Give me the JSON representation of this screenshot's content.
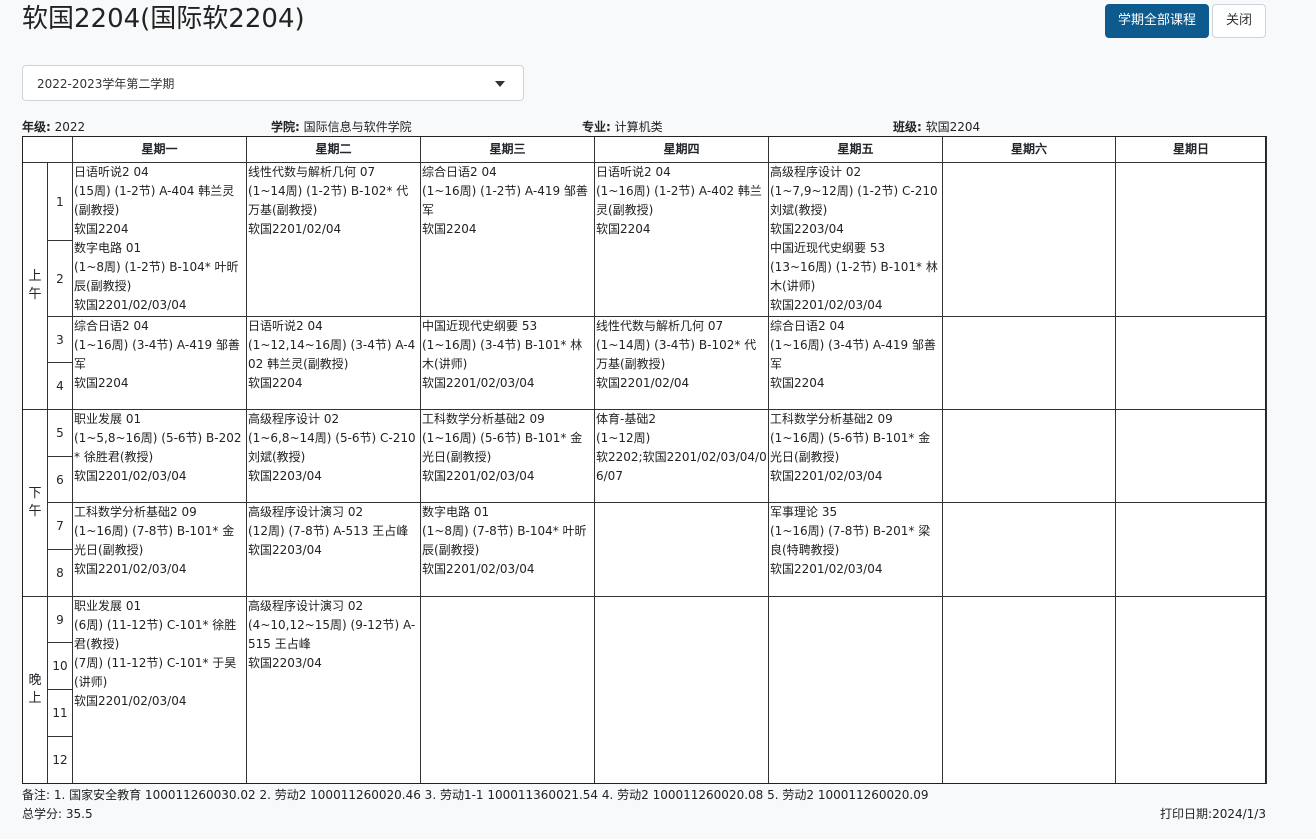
{
  "page_title": "软国2204(国际软2204)",
  "buttons": {
    "all_courses": "学期全部课程",
    "close": "关闭"
  },
  "semester_select": {
    "value": "2022-2023学年第二学期"
  },
  "info": {
    "grade_label": "年级:",
    "grade": "2022",
    "college_label": "学院:",
    "college": "国际信息与软件学院",
    "major_label": "专业:",
    "major": "计算机类",
    "class_label": "班级:",
    "class": "软国2204"
  },
  "days": [
    "星期一",
    "星期二",
    "星期三",
    "星期四",
    "星期五",
    "星期六",
    "星期日"
  ],
  "sessions": [
    "上午",
    "下午",
    "晚上"
  ],
  "periods": [
    "1",
    "2",
    "3",
    "4",
    "5",
    "6",
    "7",
    "8",
    "9",
    "10",
    "11",
    "12"
  ],
  "courses": {
    "mon_12": [
      "日语听说2 04",
      "(15周) (1-2节) A-404 韩兰灵(副教授)",
      "软国2204",
      "数字电路 01",
      "(1~8周) (1-2节) B-104* 叶昕辰(副教授)",
      "软国2201/02/03/04"
    ],
    "tue_12": [
      "线性代数与解析几何 07",
      "(1~14周) (1-2节) B-102* 代万基(副教授)",
      "软国2201/02/04"
    ],
    "wed_12": [
      "综合日语2 04",
      "(1~16周) (1-2节) A-419 邹善军",
      "软国2204"
    ],
    "thu_12": [
      "日语听说2 04",
      "(1~16周) (1-2节) A-402 韩兰灵(副教授)",
      "软国2204"
    ],
    "fri_12": [
      "高级程序设计 02",
      "(1~7,9~12周) (1-2节) C-210 刘斌(教授)",
      "软国2203/04",
      "中国近现代史纲要 53",
      "(13~16周) (1-2节) B-101* 林木(讲师)",
      "软国2201/02/03/04"
    ],
    "mon_34": [
      "综合日语2 04",
      "(1~16周) (3-4节) A-419 邹善军",
      "软国2204"
    ],
    "tue_34": [
      "日语听说2 04",
      "(1~12,14~16周) (3-4节) A-402 韩兰灵(副教授)",
      "软国2204"
    ],
    "wed_34": [
      "中国近现代史纲要 53",
      "(1~16周) (3-4节) B-101* 林木(讲师)",
      "软国2201/02/03/04"
    ],
    "thu_34": [
      "线性代数与解析几何 07",
      "(1~14周) (3-4节) B-102* 代万基(副教授)",
      "软国2201/02/04"
    ],
    "fri_34": [
      "综合日语2 04",
      "(1~16周) (3-4节) A-419 邹善军",
      "软国2204"
    ],
    "mon_56": [
      "职业发展 01",
      "(1~5,8~16周) (5-6节) B-202* 徐胜君(教授)",
      "软国2201/02/03/04"
    ],
    "tue_56": [
      "高级程序设计 02",
      "(1~6,8~14周) (5-6节) C-210 刘斌(教授)",
      "软国2203/04"
    ],
    "wed_56": [
      "工科数学分析基础2 09",
      "(1~16周) (5-6节) B-101* 金光日(副教授)",
      "软国2201/02/03/04"
    ],
    "thu_56": [
      "体育-基础2",
      "(1~12周)",
      "软2202;软国2201/02/03/04/06/07"
    ],
    "fri_56": [
      "工科数学分析基础2 09",
      "(1~16周) (5-6节) B-101* 金光日(副教授)",
      "软国2201/02/03/04"
    ],
    "mon_78": [
      "工科数学分析基础2 09",
      "(1~16周) (7-8节) B-101* 金光日(副教授)",
      "软国2201/02/03/04"
    ],
    "tue_78": [
      "高级程序设计演习 02",
      "(12周) (7-8节) A-513 王占峰",
      "软国2203/04"
    ],
    "wed_78": [
      "数字电路 01",
      "(1~8周) (7-8节) B-104* 叶昕辰(副教授)",
      "软国2201/02/03/04"
    ],
    "fri_78": [
      "军事理论 35",
      "(1~16周) (7-8节) B-201* 梁良(特聘教授)",
      "软国2201/02/03/04"
    ],
    "mon_eve": [
      "职业发展 01",
      "(6周) (11-12节) C-101* 徐胜君(教授)",
      "(7周) (11-12节)  C-101*  于昊(讲师)",
      "软国2201/02/03/04"
    ],
    "tue_eve": [
      "高级程序设计演习 02",
      "(4~10,12~15周) (9-12节) A-515 王占峰",
      "软国2203/04"
    ]
  },
  "notes": "备注:   1. 国家安全教育 100011260030.02    2. 劳动2 100011260020.46    3. 劳动1-1 100011360021.54    4. 劳动2 100011260020.08    5. 劳动2 100011260020.09",
  "total_credits": "总学分:  35.5",
  "print_date": "打印日期:2024/1/3"
}
